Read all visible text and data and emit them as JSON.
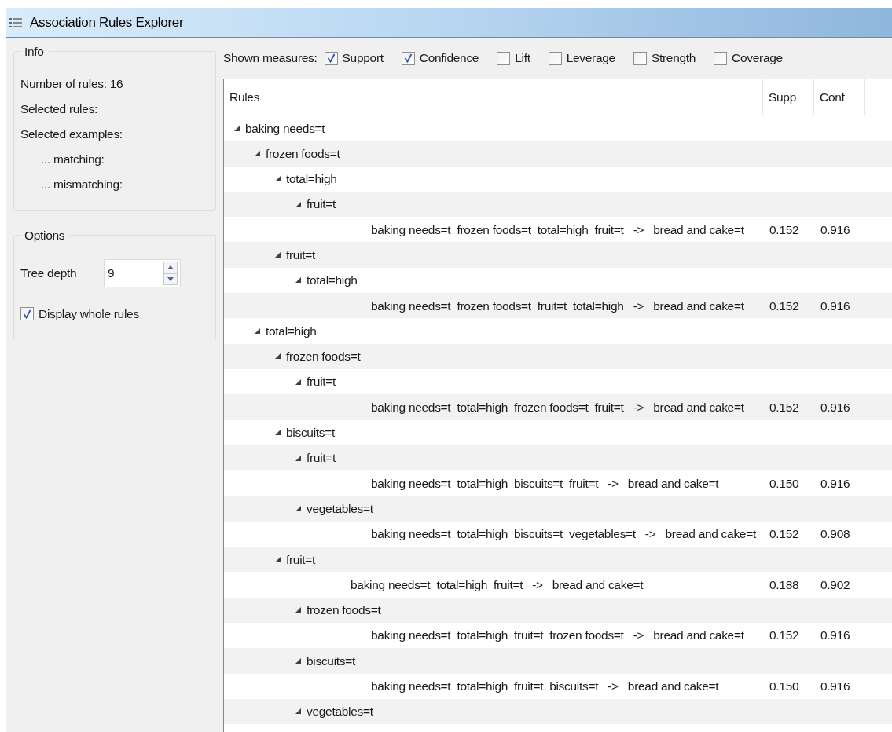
{
  "window": {
    "title": "Association Rules Explorer"
  },
  "info": {
    "title": "Info",
    "lines": [
      {
        "text": "Number of rules: 16",
        "indent": false
      },
      {
        "text": "Selected rules:",
        "indent": false
      },
      {
        "text": "Selected examples:",
        "indent": false
      },
      {
        "text": "... matching:",
        "indent": true
      },
      {
        "text": "... mismatching:",
        "indent": true
      }
    ]
  },
  "options": {
    "title": "Options",
    "tree_depth": {
      "label": "Tree depth",
      "value": "9"
    },
    "display_whole_rules": {
      "label": "Display whole rules",
      "checked": true
    }
  },
  "measures": {
    "label": "Shown measures:",
    "items": [
      {
        "label": "Support",
        "checked": true
      },
      {
        "label": "Confidence",
        "checked": true
      },
      {
        "label": "Lift",
        "checked": false
      },
      {
        "label": "Leverage",
        "checked": false
      },
      {
        "label": "Strength",
        "checked": false
      },
      {
        "label": "Coverage",
        "checked": false
      }
    ]
  },
  "table": {
    "columns": [
      "Rules",
      "Supp",
      "Conf"
    ],
    "tree": [
      {
        "kind": "node",
        "label": "baking needs=t",
        "expanded": true,
        "children": [
          {
            "kind": "node",
            "label": "frozen foods=t",
            "expanded": true,
            "children": [
              {
                "kind": "node",
                "label": "total=high",
                "expanded": true,
                "children": [
                  {
                    "kind": "node",
                    "label": "fruit=t",
                    "expanded": true,
                    "children": [
                      {
                        "kind": "rule",
                        "label": "baking needs=t  frozen foods=t  total=high  fruit=t   ->   bread and cake=t",
                        "supp": "0.152",
                        "conf": "0.916"
                      }
                    ]
                  }
                ]
              },
              {
                "kind": "node",
                "label": "fruit=t",
                "expanded": true,
                "children": [
                  {
                    "kind": "node",
                    "label": "total=high",
                    "expanded": true,
                    "children": [
                      {
                        "kind": "rule",
                        "label": "baking needs=t  frozen foods=t  fruit=t  total=high   ->   bread and cake=t",
                        "supp": "0.152",
                        "conf": "0.916"
                      }
                    ]
                  }
                ]
              }
            ]
          },
          {
            "kind": "node",
            "label": "total=high",
            "expanded": true,
            "children": [
              {
                "kind": "node",
                "label": "frozen foods=t",
                "expanded": true,
                "children": [
                  {
                    "kind": "node",
                    "label": "fruit=t",
                    "expanded": true,
                    "children": [
                      {
                        "kind": "rule",
                        "label": "baking needs=t  total=high  frozen foods=t  fruit=t   ->   bread and cake=t",
                        "supp": "0.152",
                        "conf": "0.916"
                      }
                    ]
                  }
                ]
              },
              {
                "kind": "node",
                "label": "biscuits=t",
                "expanded": true,
                "children": [
                  {
                    "kind": "node",
                    "label": "fruit=t",
                    "expanded": true,
                    "children": [
                      {
                        "kind": "rule",
                        "label": "baking needs=t  total=high  biscuits=t  fruit=t   ->   bread and cake=t",
                        "supp": "0.150",
                        "conf": "0.916"
                      }
                    ]
                  },
                  {
                    "kind": "node",
                    "label": "vegetables=t",
                    "expanded": true,
                    "children": [
                      {
                        "kind": "rule",
                        "label": "baking needs=t  total=high  biscuits=t  vegetables=t   ->   bread and cake=t",
                        "supp": "0.152",
                        "conf": "0.908"
                      }
                    ]
                  }
                ]
              },
              {
                "kind": "node",
                "label": "fruit=t",
                "expanded": true,
                "children": [
                  {
                    "kind": "rule",
                    "label": "baking needs=t  total=high  fruit=t   ->   bread and cake=t",
                    "supp": "0.188",
                    "conf": "0.902"
                  },
                  {
                    "kind": "node",
                    "label": "frozen foods=t",
                    "expanded": true,
                    "children": [
                      {
                        "kind": "rule",
                        "label": "baking needs=t  total=high  fruit=t  frozen foods=t   ->   bread and cake=t",
                        "supp": "0.152",
                        "conf": "0.916"
                      }
                    ]
                  },
                  {
                    "kind": "node",
                    "label": "biscuits=t",
                    "expanded": true,
                    "children": [
                      {
                        "kind": "rule",
                        "label": "baking needs=t  total=high  fruit=t  biscuits=t   ->   bread and cake=t",
                        "supp": "0.150",
                        "conf": "0.916"
                      }
                    ]
                  },
                  {
                    "kind": "node",
                    "label": "vegetables=t",
                    "expanded": true
                  }
                ]
              }
            ]
          }
        ]
      }
    ]
  }
}
